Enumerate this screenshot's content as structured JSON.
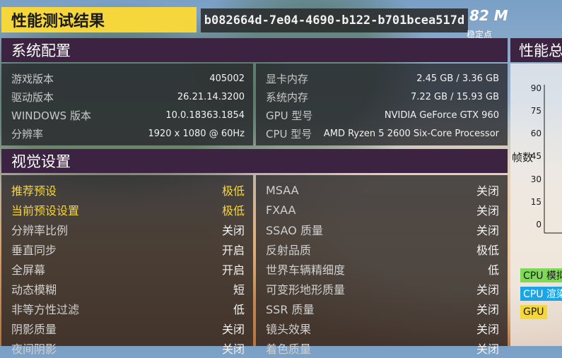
{
  "header": {
    "title": "性能测试结果",
    "guid": "b082664d-7e04-4690-b122-b701bcea517d",
    "score": "82 M",
    "score_sub": "稳定点"
  },
  "system": {
    "title": "系统配置",
    "left": [
      {
        "label": "游戏版本",
        "value": "405002"
      },
      {
        "label": "驱动版本",
        "value": "26.21.14.3200"
      },
      {
        "label": "WINDOWS 版本",
        "value": "10.0.18363.1854"
      },
      {
        "label": "分辨率",
        "value": "1920 x 1080 @ 60Hz"
      }
    ],
    "right": [
      {
        "label": "显卡内存",
        "value": "2.45 GB / 3.36 GB"
      },
      {
        "label": "系统内存",
        "value": "7.22 GB / 15.93 GB"
      },
      {
        "label": "GPU 型号",
        "value": "NVIDIA GeForce GTX 960"
      },
      {
        "label": "CPU 型号",
        "value": "AMD Ryzen 5 2600 Six-Core Processor"
      }
    ]
  },
  "visual": {
    "title": "视觉设置",
    "left": [
      {
        "label": "推荐预设",
        "value": "极低"
      },
      {
        "label": "当前预设设置",
        "value": "极低"
      },
      {
        "label": "分辨率比例",
        "value": "关闭"
      },
      {
        "label": "垂直同步",
        "value": "开启"
      },
      {
        "label": "全屏幕",
        "value": "开启"
      },
      {
        "label": "动态模糊",
        "value": "短"
      },
      {
        "label": "非等方性过滤",
        "value": "低"
      },
      {
        "label": "阴影质量",
        "value": "关闭"
      },
      {
        "label": "夜间阴影",
        "value": "关闭"
      }
    ],
    "right": [
      {
        "label": "MSAA",
        "value": "关闭"
      },
      {
        "label": "FXAA",
        "value": "关闭"
      },
      {
        "label": "SSAO 质量",
        "value": "关闭"
      },
      {
        "label": "反射品质",
        "value": "极低"
      },
      {
        "label": "世界车辆精细度",
        "value": "低"
      },
      {
        "label": "可变形地形质量",
        "value": "关闭"
      },
      {
        "label": "SSR 质量",
        "value": "关闭"
      },
      {
        "label": "镜头效果",
        "value": "关闭"
      },
      {
        "label": "着色质量",
        "value": "关闭"
      }
    ]
  },
  "performance": {
    "title": "性能总",
    "ylabel": "帧数",
    "ticks": [
      "90",
      "75",
      "60",
      "45",
      "30",
      "15",
      "0"
    ],
    "legend": [
      {
        "label": "CPU 模拟",
        "color": "#7ed957"
      },
      {
        "label": "CPU 渲染",
        "color": "#1aa6e6"
      },
      {
        "label": "GPU",
        "color": "#f5d73b"
      }
    ]
  },
  "colors": {
    "accent": "#f5d73b",
    "header_bg": "#3c2342"
  }
}
